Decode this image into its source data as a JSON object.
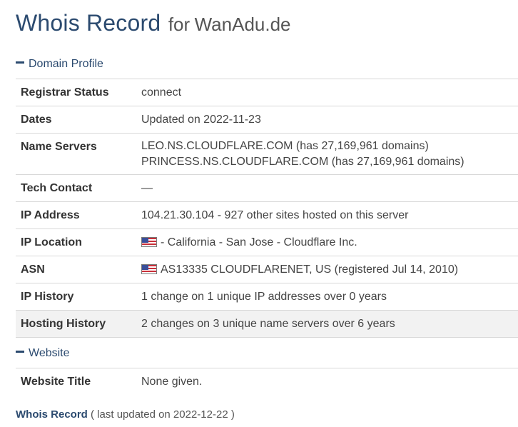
{
  "header": {
    "title_main": "Whois Record",
    "title_for": "for",
    "title_domain": "WanAdu.de"
  },
  "domain_profile": {
    "heading": "Domain Profile",
    "rows": [
      {
        "label": "Registrar Status",
        "value": "connect"
      },
      {
        "label": "Dates",
        "value": "Updated on 2022-11-23"
      },
      {
        "label": "Name Servers",
        "values": [
          "LEO.NS.CLOUDFLARE.COM (has 27,169,961 domains)",
          "PRINCESS.NS.CLOUDFLARE.COM (has 27,169,961 domains)"
        ]
      },
      {
        "label": "Tech Contact",
        "value": "—"
      },
      {
        "label": "IP Address",
        "value": "104.21.30.104 - 927 other sites hosted on this server"
      },
      {
        "label": "IP Location",
        "value": "- California - San Jose - Cloudflare Inc.",
        "icon": "us-flag-icon"
      },
      {
        "label": "ASN",
        "value": "AS13335 CLOUDFLARENET, US (registered Jul 14, 2010)",
        "icon": "us-flag-icon"
      },
      {
        "label": "IP History",
        "value": "1 change on 1 unique IP addresses over 0 years"
      },
      {
        "label": "Hosting History",
        "value": "2 changes on 3 unique name servers over 6 years"
      }
    ]
  },
  "website": {
    "heading": "Website",
    "rows": [
      {
        "label": "Website Title",
        "value": "None given."
      }
    ]
  },
  "footer": {
    "link": "Whois Record",
    "text": "( last updated on 2022-12-22 )"
  },
  "colors": {
    "heading": "#2b4a6f",
    "highlight_row": "#f2f2f2",
    "border": "#d8d8d8"
  }
}
